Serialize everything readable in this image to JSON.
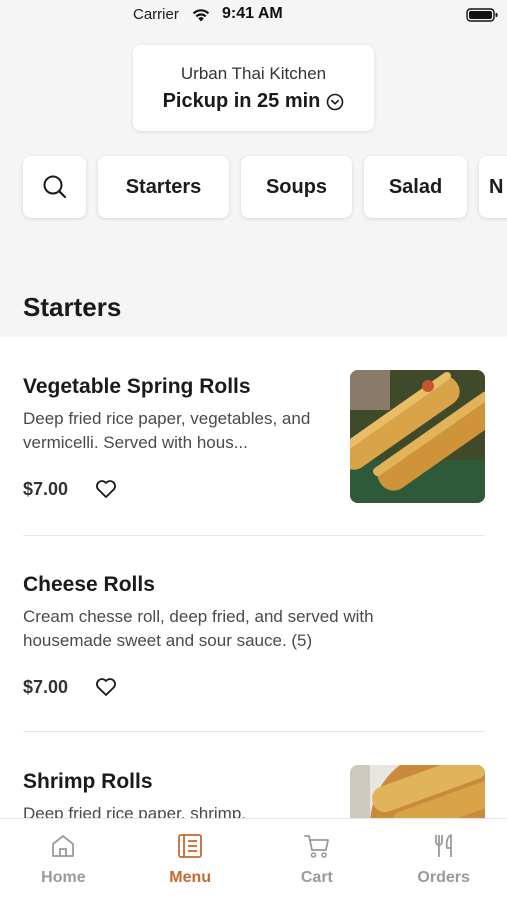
{
  "status_bar": {
    "carrier": "Carrier",
    "time": "9:41 AM"
  },
  "store": {
    "name": "Urban Thai Kitchen",
    "pickup": "Pickup in 25 min"
  },
  "categories": [
    "Starters",
    "Soups",
    "Salad",
    "N"
  ],
  "section_title": "Starters",
  "menu_items": [
    {
      "name": "Vegetable Spring Rolls",
      "description": "Deep fried rice paper, vegetables, and vermicelli. Served with hous...",
      "price": "$7.00"
    },
    {
      "name": "Cheese Rolls",
      "description": "Cream chesse roll, deep fried, and served with housemade sweet and sour sauce. (5)",
      "price": "$7.00"
    },
    {
      "name": "Shrimp Rolls",
      "description": "Deep fried rice paper, shrimp,"
    }
  ],
  "tabs": [
    {
      "label": "Home",
      "icon": "home-icon",
      "active": false
    },
    {
      "label": "Menu",
      "icon": "menu-book-icon",
      "active": true
    },
    {
      "label": "Cart",
      "icon": "cart-icon",
      "active": false
    },
    {
      "label": "Orders",
      "icon": "fork-knife-icon",
      "active": false
    }
  ],
  "colors": {
    "accent": "#c46a2f",
    "inactive": "#9a9a9a",
    "background": "#f5f5f5"
  }
}
